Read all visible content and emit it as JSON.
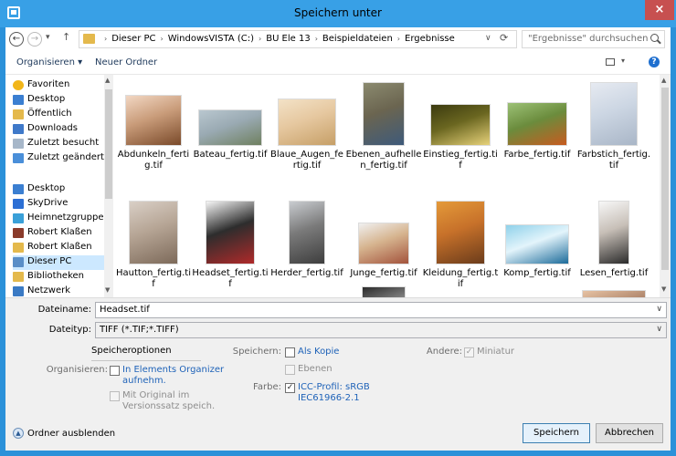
{
  "window": {
    "title": "Speichern unter",
    "close": "×"
  },
  "nav": {
    "back": "←",
    "forward": "→",
    "recent": "▾",
    "up": "↑",
    "crumbs": [
      "Dieser PC",
      "WindowsVISTA (C:)",
      "BU Ele 13",
      "Beispieldateien",
      "Ergebnisse"
    ],
    "crumb_sep": "›",
    "dropdown": "∨",
    "refresh": "⟳",
    "search_placeholder": "\"Ergebnisse\" durchsuchen"
  },
  "toolbar": {
    "organize": "Organisieren ▾",
    "new_folder": "Neuer Ordner",
    "view_dd": "▾",
    "help": "?"
  },
  "sidebar": {
    "scroll_up": "▲",
    "scroll_down": "▼",
    "items": [
      {
        "label": "Favoriten",
        "icon": "star-icon",
        "color": "#f2b619"
      },
      {
        "label": "Desktop",
        "icon": "desktop-icon",
        "color": "#3b7fd1"
      },
      {
        "label": "Öffentlich",
        "icon": "folder-icon",
        "color": "#e4b94c"
      },
      {
        "label": "Downloads",
        "icon": "downloads-icon",
        "color": "#3f79c9"
      },
      {
        "label": "Zuletzt besucht",
        "icon": "recent-places-icon",
        "color": "#a7b7c9"
      },
      {
        "label": "Zuletzt geändert",
        "icon": "recent-changed-icon",
        "color": "#4a8fd9"
      },
      {
        "label": "Desktop",
        "icon": "desktop-icon",
        "color": "#3b7fd1"
      },
      {
        "label": "SkyDrive",
        "icon": "skydrive-icon",
        "color": "#2c6fd4"
      },
      {
        "label": "Heimnetzgruppe",
        "icon": "homegroup-icon",
        "color": "#3aa0d8"
      },
      {
        "label": "Robert Klaßen",
        "icon": "user-icon",
        "color": "#8a3b2b"
      },
      {
        "label": "Robert Klaßen",
        "icon": "user-folder-icon",
        "color": "#e4b94c"
      },
      {
        "label": "Dieser PC",
        "icon": "computer-icon",
        "color": "#5a8ec7"
      },
      {
        "label": "Bibliotheken",
        "icon": "libraries-icon",
        "color": "#e4b94c"
      },
      {
        "label": "Netzwerk",
        "icon": "network-icon",
        "color": "#3a7ac4"
      }
    ]
  },
  "files": [
    {
      "name": "Abdunkeln_fertig.tif",
      "colors": [
        "#f2d7c3",
        "#7a4a2a",
        "#c99c7a"
      ]
    },
    {
      "name": "Bateau_fertig.tif",
      "colors": [
        "#b9c7cf",
        "#6f8060",
        "#9aaab3"
      ]
    },
    {
      "name": "Blaue_Augen_fertig.tif",
      "colors": [
        "#f3e2c7",
        "#c69f67",
        "#e6c8a0"
      ]
    },
    {
      "name": "Ebenen_aufhellen_fertig.tif",
      "colors": [
        "#8b8a6f",
        "#3e5a7a",
        "#6b6550"
      ]
    },
    {
      "name": "Einstieg_fertig.tif",
      "colors": [
        "#3b3a0f",
        "#e7d27a",
        "#6a6620"
      ]
    },
    {
      "name": "Farbe_fertig.tif",
      "colors": [
        "#9cc176",
        "#c75b1f",
        "#6b8c3d"
      ]
    },
    {
      "name": "Farbstich_fertig.tif",
      "colors": [
        "#e6eaf1",
        "#a9b6c7",
        "#ccd6e3"
      ]
    },
    {
      "name": "Hautton_fertig.tif",
      "colors": [
        "#d9cfc6",
        "#7d6a5a",
        "#b6a595"
      ]
    },
    {
      "name": "Headset_fertig.tif",
      "colors": [
        "#f5f5f5",
        "#b02a2a",
        "#2d2d2d"
      ]
    },
    {
      "name": "Herder_fertig.tif",
      "colors": [
        "#c9ccd0",
        "#3e3e3e",
        "#7a7a7a"
      ]
    },
    {
      "name": "Junge_fertig.tif",
      "colors": [
        "#f0f0f0",
        "#a3533c",
        "#d6b48f"
      ]
    },
    {
      "name": "Kleidung_fertig.tif",
      "colors": [
        "#e49a3a",
        "#6b3c1b",
        "#c7712a"
      ]
    },
    {
      "name": "Komp_fertig.tif",
      "colors": [
        "#8fd1ea",
        "#1c6b9a",
        "#e3f4fb"
      ]
    },
    {
      "name": "Lesen_fertig.tif",
      "colors": [
        "#f7f7f7",
        "#2b2b2b",
        "#c7bfb7"
      ]
    }
  ],
  "partial_row": [
    {
      "colors": [
        "#a7c3dc",
        "#5a8fc0"
      ]
    },
    {
      "colors": [
        "#9cc1e0",
        "#6b9dca"
      ]
    },
    {
      "colors": [
        "#f0f0f0",
        "#8a8a8a"
      ]
    },
    {
      "colors": [
        "#2b2b2b",
        "#d8d8d8"
      ]
    },
    {
      "colors": [
        "#5f9fd4",
        "#2e6fa7"
      ]
    },
    {
      "colors": [
        "#fbe6b2",
        "#f0a01e"
      ]
    },
    {
      "colors": [
        "#e6c2a3",
        "#7a4b36"
      ]
    }
  ],
  "save": {
    "filename_label": "Dateiname:",
    "filename": "Headset.tif",
    "filetype_label": "Dateityp:",
    "filetype": "TIFF (*.TIF;*.TIFF)",
    "dropdown": "∨"
  },
  "options": {
    "title": "Speicheroptionen",
    "organize_label": "Organisieren:",
    "organizer_line1": "In Elements Organizer",
    "organizer_line2": "aufnehm.",
    "original_line1": "Mit Original im",
    "original_line2": "Versionssatz speich.",
    "save_label": "Speichern:",
    "copy": "Als Kopie",
    "layers": "Ebenen",
    "color_label": "Farbe:",
    "icc_line1": "ICC-Profil: sRGB",
    "icc_line2": "IEC61966-2.1",
    "other_label": "Andere:",
    "thumbnail": "Miniatur",
    "check": "✓"
  },
  "footer": {
    "hide_folders": "Ordner ausblenden",
    "hide_icon": "▲",
    "save_button": "Speichern",
    "cancel_button": "Abbrechen"
  }
}
